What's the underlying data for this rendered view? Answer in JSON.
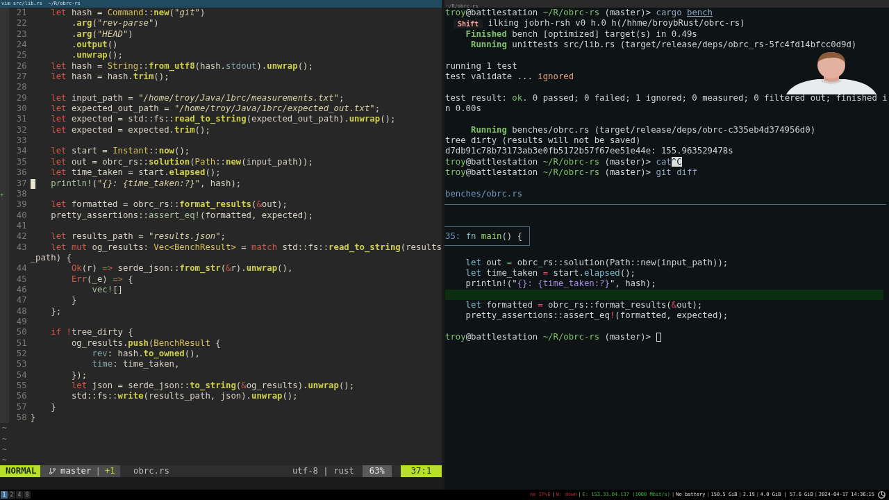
{
  "window": {
    "title": "vim src/lib.rs  ~/R/obrc-rs",
    "terminal_title": "~/R/obrc-rs"
  },
  "editor": {
    "lines": [
      {
        "n": "21",
        "cursor": false,
        "seg": [
          {
            "kind": "keyword",
            "text": "    let"
          },
          {
            "kind": "plain",
            "text": " hash = "
          },
          {
            "kind": "type",
            "text": "Command"
          },
          {
            "kind": "plain",
            "text": "::"
          },
          {
            "kind": "function",
            "text": "new"
          },
          {
            "kind": "plain",
            "text": "("
          },
          {
            "kind": "string",
            "text": "\"git\""
          },
          {
            "kind": "plain",
            "text": ")"
          }
        ]
      },
      {
        "n": "22",
        "cursor": false,
        "seg": [
          {
            "kind": "plain",
            "text": "        ."
          },
          {
            "kind": "function",
            "text": "arg"
          },
          {
            "kind": "plain",
            "text": "("
          },
          {
            "kind": "string",
            "text": "\"rev-parse\""
          },
          {
            "kind": "plain",
            "text": ")"
          }
        ]
      },
      {
        "n": "23",
        "cursor": false,
        "seg": [
          {
            "kind": "plain",
            "text": "        ."
          },
          {
            "kind": "function",
            "text": "arg"
          },
          {
            "kind": "plain",
            "text": "("
          },
          {
            "kind": "string",
            "text": "\"HEAD\""
          },
          {
            "kind": "plain",
            "text": ")"
          }
        ]
      },
      {
        "n": "24",
        "cursor": false,
        "seg": [
          {
            "kind": "plain",
            "text": "        ."
          },
          {
            "kind": "function",
            "text": "output"
          },
          {
            "kind": "plain",
            "text": "()"
          }
        ]
      },
      {
        "n": "25",
        "cursor": false,
        "seg": [
          {
            "kind": "plain",
            "text": "        ."
          },
          {
            "kind": "function",
            "text": "unwrap"
          },
          {
            "kind": "plain",
            "text": "();"
          }
        ]
      },
      {
        "n": "26",
        "cursor": false,
        "seg": [
          {
            "kind": "keyword",
            "text": "    let"
          },
          {
            "kind": "plain",
            "text": " hash = "
          },
          {
            "kind": "type",
            "text": "String"
          },
          {
            "kind": "plain",
            "text": "::"
          },
          {
            "kind": "function",
            "text": "from_utf8"
          },
          {
            "kind": "plain",
            "text": "(hash."
          },
          {
            "kind": "field",
            "text": "stdout"
          },
          {
            "kind": "plain",
            "text": ")."
          },
          {
            "kind": "function",
            "text": "unwrap"
          },
          {
            "kind": "plain",
            "text": "();"
          }
        ]
      },
      {
        "n": "27",
        "cursor": false,
        "seg": [
          {
            "kind": "keyword",
            "text": "    let"
          },
          {
            "kind": "plain",
            "text": " hash = hash."
          },
          {
            "kind": "function",
            "text": "trim"
          },
          {
            "kind": "plain",
            "text": "();"
          }
        ]
      },
      {
        "n": "28",
        "cursor": false
      },
      {
        "n": "29",
        "cursor": false,
        "seg": [
          {
            "kind": "keyword",
            "text": "    let"
          },
          {
            "kind": "plain",
            "text": " input_path = "
          },
          {
            "kind": "string",
            "text": "\"/home/troy/Java/1brc/measurements.txt\""
          },
          {
            "kind": "plain",
            "text": ";"
          }
        ]
      },
      {
        "n": "30",
        "cursor": false,
        "seg": [
          {
            "kind": "keyword",
            "text": "    let"
          },
          {
            "kind": "plain",
            "text": " expected_out_path = "
          },
          {
            "kind": "string",
            "text": "\"/home/troy/Java/1brc/expected_out.txt\""
          },
          {
            "kind": "plain",
            "text": ";"
          }
        ]
      },
      {
        "n": "31",
        "cursor": false,
        "seg": [
          {
            "kind": "keyword",
            "text": "    let"
          },
          {
            "kind": "plain",
            "text": " expected = std::fs::"
          },
          {
            "kind": "function",
            "text": "read_to_string"
          },
          {
            "kind": "plain",
            "text": "(expected_out_path)."
          },
          {
            "kind": "function",
            "text": "unwrap"
          },
          {
            "kind": "plain",
            "text": "();"
          }
        ]
      },
      {
        "n": "32",
        "cursor": false,
        "seg": [
          {
            "kind": "keyword",
            "text": "    let"
          },
          {
            "kind": "plain",
            "text": " expected = expected."
          },
          {
            "kind": "function",
            "text": "trim"
          },
          {
            "kind": "plain",
            "text": "();"
          }
        ]
      },
      {
        "n": "33",
        "cursor": false
      },
      {
        "n": "34",
        "cursor": false,
        "seg": [
          {
            "kind": "keyword",
            "text": "    let"
          },
          {
            "kind": "plain",
            "text": " start = "
          },
          {
            "kind": "type",
            "text": "Instant"
          },
          {
            "kind": "plain",
            "text": "::"
          },
          {
            "kind": "function",
            "text": "now"
          },
          {
            "kind": "plain",
            "text": "();"
          }
        ]
      },
      {
        "n": "35",
        "cursor": false,
        "seg": [
          {
            "kind": "keyword",
            "text": "    let"
          },
          {
            "kind": "plain",
            "text": " out = obrc_rs::"
          },
          {
            "kind": "function",
            "text": "solution"
          },
          {
            "kind": "plain",
            "text": "("
          },
          {
            "kind": "type",
            "text": "Path"
          },
          {
            "kind": "plain",
            "text": "::"
          },
          {
            "kind": "function",
            "text": "new"
          },
          {
            "kind": "plain",
            "text": "(input_path));"
          }
        ]
      },
      {
        "n": "36",
        "cursor": false,
        "seg": [
          {
            "kind": "keyword",
            "text": "    let"
          },
          {
            "kind": "plain",
            "text": " time_taken = start."
          },
          {
            "kind": "function",
            "text": "elapsed"
          },
          {
            "kind": "plain",
            "text": "();"
          }
        ]
      },
      {
        "n": "37",
        "cursor": true,
        "seg": [
          {
            "kind": "macro",
            "text": "   println!"
          },
          {
            "kind": "plain",
            "text": "("
          },
          {
            "kind": "string",
            "text": "\"{}: {time_taken:?}\""
          },
          {
            "kind": "plain",
            "text": ", hash);"
          }
        ]
      },
      {
        "n": "38",
        "cursor": false,
        "sign": "+"
      },
      {
        "n": "39",
        "cursor": false,
        "seg": [
          {
            "kind": "keyword",
            "text": "    let"
          },
          {
            "kind": "plain",
            "text": " formatted = obrc_rs::"
          },
          {
            "kind": "function",
            "text": "format_results"
          },
          {
            "kind": "plain",
            "text": "("
          },
          {
            "kind": "keyword",
            "text": "&"
          },
          {
            "kind": "plain",
            "text": "out);"
          }
        ]
      },
      {
        "n": "40",
        "cursor": false,
        "seg": [
          {
            "kind": "plain",
            "text": "    pretty_assertions::"
          },
          {
            "kind": "macro",
            "text": "assert_eq!"
          },
          {
            "kind": "plain",
            "text": "(formatted, expected);"
          }
        ]
      },
      {
        "n": "41",
        "cursor": false
      },
      {
        "n": "42",
        "cursor": false,
        "seg": [
          {
            "kind": "keyword",
            "text": "    let"
          },
          {
            "kind": "plain",
            "text": " results_path = "
          },
          {
            "kind": "string",
            "text": "\"results.json\""
          },
          {
            "kind": "plain",
            "text": ";"
          }
        ]
      },
      {
        "n": "43",
        "cursor": false,
        "seg": [
          {
            "kind": "keyword",
            "text": "    let mut"
          },
          {
            "kind": "plain",
            "text": " og_results: "
          },
          {
            "kind": "type",
            "text": "Vec<BenchResult>"
          },
          {
            "kind": "plain",
            "text": " = "
          },
          {
            "kind": "keyword",
            "text": "match"
          },
          {
            "kind": "plain",
            "text": " std::fs::"
          },
          {
            "kind": "function",
            "text": "read_to_string"
          },
          {
            "kind": "plain",
            "text": "(results"
          }
        ]
      },
      {
        "cursor": false,
        "seg": [
          {
            "kind": "plain",
            "text": "_path) {"
          }
        ]
      },
      {
        "n": "44",
        "cursor": false,
        "seg": [
          {
            "kind": "keyword",
            "text": "        Ok"
          },
          {
            "kind": "plain",
            "text": "(r) "
          },
          {
            "kind": "keyword",
            "text": "=>"
          },
          {
            "kind": "plain",
            "text": " serde_json::"
          },
          {
            "kind": "function",
            "text": "from_str"
          },
          {
            "kind": "plain",
            "text": "("
          },
          {
            "kind": "keyword",
            "text": "&"
          },
          {
            "kind": "plain",
            "text": "r)."
          },
          {
            "kind": "function",
            "text": "unwrap"
          },
          {
            "kind": "plain",
            "text": "(),"
          }
        ]
      },
      {
        "n": "45",
        "cursor": false,
        "seg": [
          {
            "kind": "keyword",
            "text": "        Err"
          },
          {
            "kind": "plain",
            "text": "(_e) "
          },
          {
            "kind": "keyword",
            "text": "=>"
          },
          {
            "kind": "plain",
            "text": " {"
          }
        ]
      },
      {
        "n": "46",
        "cursor": false,
        "seg": [
          {
            "kind": "macro",
            "text": "            vec!"
          },
          {
            "kind": "plain",
            "text": "[]"
          }
        ]
      },
      {
        "n": "47",
        "cursor": false,
        "seg": [
          {
            "kind": "plain",
            "text": "        }"
          }
        ]
      },
      {
        "n": "48",
        "cursor": false,
        "seg": [
          {
            "kind": "plain",
            "text": "    };"
          }
        ]
      },
      {
        "n": "49",
        "cursor": false
      },
      {
        "n": "50",
        "cursor": false,
        "seg": [
          {
            "kind": "keyword",
            "text": "    if !"
          },
          {
            "kind": "plain",
            "text": "tree_dirty {"
          }
        ]
      },
      {
        "n": "51",
        "cursor": false,
        "seg": [
          {
            "kind": "plain",
            "text": "        og_results."
          },
          {
            "kind": "function",
            "text": "push"
          },
          {
            "kind": "plain",
            "text": "("
          },
          {
            "kind": "type",
            "text": "BenchResult"
          },
          {
            "kind": "plain",
            "text": " {"
          }
        ]
      },
      {
        "n": "52",
        "cursor": false,
        "seg": [
          {
            "kind": "field",
            "text": "            rev"
          },
          {
            "kind": "plain",
            "text": ": hash."
          },
          {
            "kind": "function",
            "text": "to_owned"
          },
          {
            "kind": "plain",
            "text": "(),"
          }
        ]
      },
      {
        "n": "53",
        "cursor": false,
        "seg": [
          {
            "kind": "field",
            "text": "            time"
          },
          {
            "kind": "plain",
            "text": ": time_taken,"
          }
        ]
      },
      {
        "n": "54",
        "cursor": false,
        "seg": [
          {
            "kind": "plain",
            "text": "        });"
          }
        ]
      },
      {
        "n": "55",
        "cursor": false,
        "seg": [
          {
            "kind": "keyword",
            "text": "        let"
          },
          {
            "kind": "plain",
            "text": " json = serde_json::"
          },
          {
            "kind": "function",
            "text": "to_string"
          },
          {
            "kind": "plain",
            "text": "("
          },
          {
            "kind": "keyword",
            "text": "&"
          },
          {
            "kind": "plain",
            "text": "og_results)."
          },
          {
            "kind": "function",
            "text": "unwrap"
          },
          {
            "kind": "plain",
            "text": "();"
          }
        ]
      },
      {
        "n": "56",
        "cursor": false,
        "seg": [
          {
            "kind": "plain",
            "text": "        std::fs::"
          },
          {
            "kind": "function",
            "text": "write"
          },
          {
            "kind": "plain",
            "text": "(results_path, json)."
          },
          {
            "kind": "function",
            "text": "unwrap"
          },
          {
            "kind": "plain",
            "text": "();"
          }
        ]
      },
      {
        "n": "57",
        "cursor": false,
        "seg": [
          {
            "kind": "plain",
            "text": "    }"
          }
        ]
      },
      {
        "n": "58",
        "cursor": false,
        "seg": [
          {
            "kind": "plain",
            "text": "}"
          }
        ]
      }
    ],
    "tildes": [
      "~",
      "~",
      "~",
      "~"
    ],
    "status_line": {
      "mode": "NORMAL",
      "branch": "master",
      "separator": "|",
      "changes": "+1",
      "file": "obrc.rs",
      "encoding": "utf-8 | rust",
      "percent": "63%",
      "position": "37:1"
    }
  },
  "terminal": {
    "lines": [
      {
        "seg": [
          {
            "kind": "user",
            "text": "troy"
          },
          {
            "kind": "plain",
            "text": "@battlestation"
          },
          {
            "kind": "path",
            "text": " ~/R/obrc-rs"
          },
          {
            "kind": "plain",
            "text": " (master)> "
          },
          {
            "kind": "command",
            "text": "cargo "
          },
          {
            "kind": "link",
            "text": "bench"
          }
        ]
      },
      {
        "badge": "Shift",
        "seg": [
          {
            "kind": "plain",
            "text": " ilking jobrh-rsh v0 h.0 h(/hhme/broybRust/obrc-rs)"
          }
        ]
      },
      {
        "seg": [
          {
            "kind": "status",
            "text": "    Finished"
          },
          {
            "kind": "plain",
            "text": " bench [optimized] target(s) in 0.49s"
          }
        ]
      },
      {
        "seg": [
          {
            "kind": "status",
            "text": "     Running"
          },
          {
            "kind": "plain",
            "text": " unittests src/lib.rs (target/release/deps/obrc_rs-5fc4fd14bfcc0d9d)"
          }
        ]
      },
      {
        "gap_before": true,
        "seg": [
          {
            "kind": "plain",
            "text": "running 1 test"
          }
        ]
      },
      {
        "seg": [
          {
            "kind": "plain",
            "text": "test validate ... "
          },
          {
            "kind": "warning",
            "text": "ignored"
          }
        ]
      },
      {
        "gap_before": true,
        "seg": [
          {
            "kind": "plain",
            "text": "test result: "
          },
          {
            "kind": "ok",
            "text": "ok"
          },
          {
            "kind": "plain",
            "text": ". 0 passed; 0 failed; 1 ignored; 0 measured; 0 filtered out; finished i"
          }
        ]
      },
      {
        "seg": [
          {
            "kind": "plain",
            "text": "n 0.00s"
          }
        ]
      },
      {
        "gap_before": true,
        "seg": [
          {
            "kind": "status",
            "text": "     Running"
          },
          {
            "kind": "plain",
            "text": " benches/obrc.rs (target/release/deps/obrc-c335eb4d374956d0)"
          }
        ]
      },
      {
        "seg": [
          {
            "kind": "plain",
            "text": "tree dirty (results will not be saved)"
          }
        ]
      },
      {
        "seg": [
          {
            "kind": "plain",
            "text": "d7db91c78b73173ab3e0fb5172b57f67ee51e44e: 155.963529478s"
          }
        ]
      },
      {
        "seg": [
          {
            "kind": "user",
            "text": "troy"
          },
          {
            "kind": "plain",
            "text": "@battlestation"
          },
          {
            "kind": "path",
            "text": " ~/R/obrc-rs"
          },
          {
            "kind": "plain",
            "text": " (master)> "
          },
          {
            "kind": "command",
            "text": "cat"
          },
          {
            "kind": "inverse",
            "text": "^C"
          }
        ]
      },
      {
        "seg": [
          {
            "kind": "user",
            "text": "troy"
          },
          {
            "kind": "plain",
            "text": "@battlestation"
          },
          {
            "kind": "path",
            "text": " ~/R/obrc-rs"
          },
          {
            "kind": "plain",
            "text": " (master)> "
          },
          {
            "kind": "command",
            "text": "git diff"
          }
        ]
      },
      {
        "gap_before": true,
        "seg": [
          {
            "kind": "file",
            "text": "benches/obrc.rs"
          }
        ]
      }
    ],
    "diff": {
      "hunk": [
        {
          "kind": "hunkno",
          "text": "35: "
        },
        {
          "kind": "fn",
          "text": "fn"
        },
        {
          "kind": "name",
          "text": " main"
        },
        {
          "kind": "plain",
          "text": "() {"
        }
      ],
      "lines": [
        {
          "added": false
        },
        {
          "added": false,
          "seg": [
            {
              "kind": "let",
              "text": "    let"
            },
            {
              "kind": "plain",
              "text": " out "
            },
            {
              "kind": "op",
              "text": "="
            },
            {
              "kind": "plain",
              "text": " obrc_rs::solution(Path::new(input_path));"
            }
          ]
        },
        {
          "added": false,
          "seg": [
            {
              "kind": "let",
              "text": "    let"
            },
            {
              "kind": "plain",
              "text": " time_taken "
            },
            {
              "kind": "op",
              "text": "="
            },
            {
              "kind": "plain",
              "text": " start."
            },
            {
              "kind": "method",
              "text": "elapsed"
            },
            {
              "kind": "plain",
              "text": "();"
            }
          ]
        },
        {
          "added": false,
          "seg": [
            {
              "kind": "plain",
              "text": "    println!(\""
            },
            {
              "kind": "fmt",
              "text": "{}: {time_taken:?}"
            },
            {
              "kind": "plain",
              "text": "\", hash);"
            }
          ]
        },
        {
          "added": true
        },
        {
          "added": false,
          "seg": [
            {
              "kind": "let",
              "text": "    let"
            },
            {
              "kind": "plain",
              "text": " formatted "
            },
            {
              "kind": "op",
              "text": "="
            },
            {
              "kind": "plain",
              "text": " obrc_rs::format_results("
            },
            {
              "kind": "op",
              "text": "&"
            },
            {
              "kind": "plain",
              "text": "out);"
            }
          ]
        },
        {
          "added": false,
          "seg": [
            {
              "kind": "plain",
              "text": "    pretty_assertions::assert_eq"
            },
            {
              "kind": "op",
              "text": "!"
            },
            {
              "kind": "plain",
              "text": "(formatted, expected);"
            }
          ]
        },
        {
          "added": false
        }
      ],
      "prompt": [
        {
          "kind": "user",
          "text": "troy"
        },
        {
          "kind": "plain",
          "text": "@battlestation"
        },
        {
          "kind": "path",
          "text": " ~/R/obrc-rs"
        },
        {
          "kind": "plain",
          "text": " (master)> "
        }
      ]
    }
  },
  "bar": {
    "workspaces": [
      {
        "label": "1",
        "selected": true
      },
      {
        "label": "2",
        "selected": false
      },
      {
        "label": "4",
        "selected": false
      },
      {
        "label": "8",
        "selected": false
      }
    ],
    "status": [
      {
        "kind": "bad",
        "text": "no IPv6"
      },
      {
        "kind": "bad",
        "text": "W: down"
      },
      {
        "kind": "good",
        "text": "E: 153.33.04.137 (1000 Mbit/s)"
      },
      {
        "kind": "plain",
        "text": "No battery"
      },
      {
        "kind": "plain",
        "text": "150.5 GiB"
      },
      {
        "kind": "plain",
        "text": "2.19"
      },
      {
        "kind": "plain",
        "text": "4.0 GiB | 57.6 GiB"
      },
      {
        "kind": "plain",
        "text": "2024-04-17 14:36:15"
      }
    ],
    "separator": "|"
  }
}
